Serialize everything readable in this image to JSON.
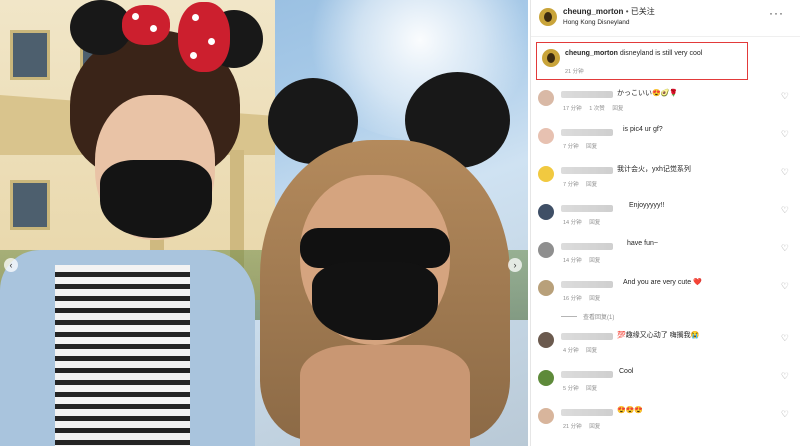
{
  "post": {
    "author": "cheung_morton",
    "separator": "•",
    "follow_status": "已关注",
    "location": "Hong Kong Disneyland",
    "more_label": "···",
    "photo_prev": "‹",
    "photo_next": "›"
  },
  "caption": {
    "author": "cheung_morton",
    "text": "disneyland is still very cool",
    "time": "21 分钟"
  },
  "comments": [
    {
      "text": "かっこいい😍🥑🌹",
      "time": "17 分钟",
      "likes": "1 次赞",
      "reply": "回复",
      "avatar_color": "#d9b9a6"
    },
    {
      "text": "is pic4 ur gf?",
      "time": "7 分钟",
      "likes": "",
      "reply": "回复",
      "avatar_color": "#e7c1b1"
    },
    {
      "text": "我计会火，yxh记觉系列",
      "time": "7 分钟",
      "likes": "",
      "reply": "回复",
      "avatar_color": "#f1c940"
    },
    {
      "text": "Enjoyyyyy!!",
      "time": "14 分钟",
      "likes": "",
      "reply": "回复",
      "avatar_color": "#3f4f66"
    },
    {
      "text": "have fun~",
      "time": "14 分钟",
      "likes": "",
      "reply": "回复",
      "avatar_color": "#8f8f8f"
    },
    {
      "text": "And you are very cute ❤️",
      "time": "16 分钟",
      "likes": "",
      "reply": "回复",
      "avatar_color": "#b8a07a"
    },
    {
      "text": "💯趣缘又心动了 嗨搁我😭",
      "time": "4 分钟",
      "likes": "",
      "reply": "回复",
      "avatar_color": "#6b5a4e"
    },
    {
      "text": "Cool",
      "time": "5 分钟",
      "likes": "",
      "reply": "回复",
      "avatar_color": "#5e8a3a"
    },
    {
      "text": "😍😍😍",
      "time": "21 分钟",
      "likes": "",
      "reply": "回复",
      "avatar_color": "#d8b59c"
    }
  ],
  "replies_label": "查看回复(1)",
  "heart_icon_char": "♡"
}
